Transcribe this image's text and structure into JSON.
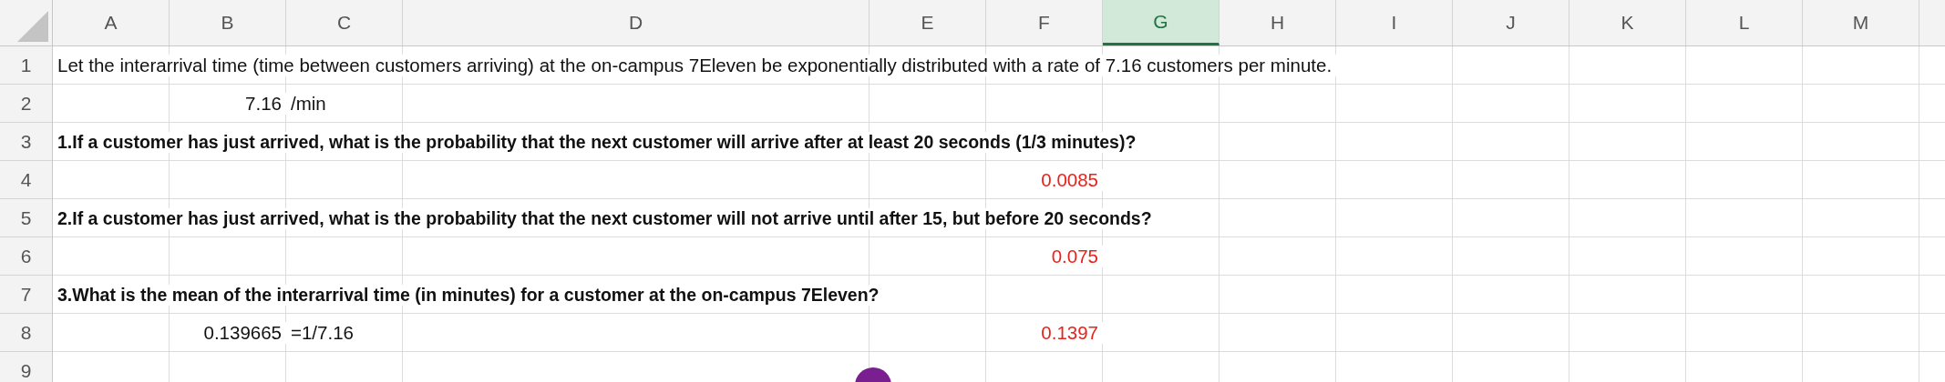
{
  "columns": [
    {
      "label": "A",
      "selected": false
    },
    {
      "label": "B",
      "selected": false
    },
    {
      "label": "C",
      "selected": false
    },
    {
      "label": "D",
      "selected": false
    },
    {
      "label": "E",
      "selected": false
    },
    {
      "label": "F",
      "selected": false
    },
    {
      "label": "G",
      "selected": true
    },
    {
      "label": "H",
      "selected": false
    },
    {
      "label": "I",
      "selected": false
    },
    {
      "label": "J",
      "selected": false
    },
    {
      "label": "K",
      "selected": false
    },
    {
      "label": "L",
      "selected": false
    },
    {
      "label": "M",
      "selected": false
    }
  ],
  "rows": [
    {
      "number": "1",
      "cells": {
        "A": {
          "kind": "text",
          "text": "Let the interarrival time (time between customers arriving) at the on-campus 7Eleven be exponentially distributed with a rate of 7.16 customers per minute."
        }
      }
    },
    {
      "number": "2",
      "cells": {
        "B": {
          "kind": "number",
          "text": "7.16"
        },
        "C": {
          "kind": "text",
          "text": "/min"
        }
      }
    },
    {
      "number": "3",
      "cells": {
        "A": {
          "kind": "question",
          "text": "1.If a customer has just arrived, what is the probability that the next customer will arrive after at least 20 seconds (1/3 minutes)?"
        }
      }
    },
    {
      "number": "4",
      "cells": {
        "F": {
          "kind": "answer",
          "text": "0.0085"
        }
      }
    },
    {
      "number": "5",
      "cells": {
        "A": {
          "kind": "question",
          "text": "2.If a customer has just arrived, what is the probability that the next customer will not arrive until after 15, but before 20 seconds?"
        }
      }
    },
    {
      "number": "6",
      "cells": {
        "F": {
          "kind": "answer",
          "text": "0.075"
        }
      }
    },
    {
      "number": "7",
      "cells": {
        "A": {
          "kind": "question",
          "text": "3.What is the mean of the interarrival time (in minutes) for a customer at the on-campus 7Eleven?"
        }
      }
    },
    {
      "number": "8",
      "cells": {
        "B": {
          "kind": "number",
          "text": "0.139665"
        },
        "C": {
          "kind": "text",
          "text": "=1/7.16"
        },
        "F": {
          "kind": "answer",
          "text": "0.1397"
        }
      }
    },
    {
      "number": "9"
    }
  ]
}
